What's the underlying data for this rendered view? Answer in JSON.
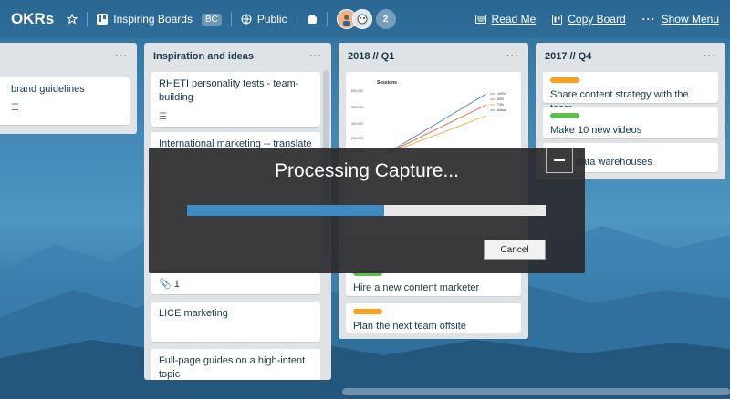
{
  "topbar": {
    "board_title": "OKRs",
    "team_name": "Inspiring Boards",
    "team_badge": "BC",
    "visibility": "Public",
    "member_count": "2",
    "read_me": "Read Me",
    "copy_board": "Copy Board",
    "show_menu": "Show Menu"
  },
  "lists": [
    {
      "title": "",
      "cards": [
        {
          "title": "brand guidelines"
        }
      ]
    },
    {
      "title": "Inspiration and ideas",
      "cards": [
        {
          "title": "RHETI personality tests - team-building"
        },
        {
          "title": "International marketing -- translate"
        },
        {
          "title": "Full-page guides on a high-intent topic"
        },
        {
          "title": "LICE marketing"
        },
        {
          "attachment_count": "1"
        }
      ]
    },
    {
      "title": "2018 // Q1",
      "cards": [
        {
          "title": "Hire a new content marketer"
        },
        {
          "title": "Plan the next team offsite"
        }
      ],
      "chart_title": "Sessions",
      "chart_yticks": [
        "600,000",
        "400,000",
        "300,000",
        "200,000",
        "150,000"
      ],
      "chart_legend": [
        "100%",
        "85%",
        "70%",
        "Actual"
      ]
    },
    {
      "title": "2017 // Q4",
      "cards": [
        {
          "title": "Share content strategy with the team"
        },
        {
          "title": "Make 10 new videos"
        },
        {
          "title": "data warehouses"
        }
      ]
    }
  ],
  "overlay": {
    "title": "Processing Capture...",
    "cancel_label": "Cancel",
    "progress": 0.55
  },
  "colors": {
    "label_green": "#61bd4f",
    "label_orange": "#ff9f1a",
    "progress": "#3f8ac5"
  }
}
